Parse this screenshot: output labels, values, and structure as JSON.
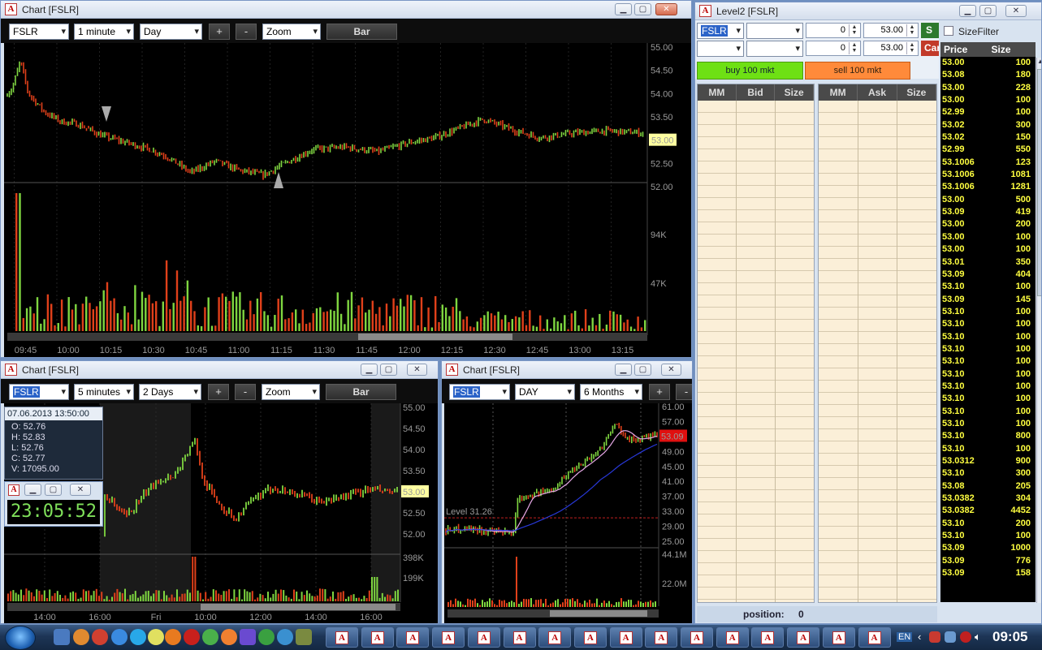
{
  "chart_main": {
    "title": "Chart [FSLR]",
    "symbol": "FSLR",
    "interval": "1 minute",
    "range": "Day",
    "zoom_plus": "+",
    "zoom_minus": "-",
    "zoom": "Zoom",
    "style": "Bar",
    "price_ticks": [
      "55.00",
      "54.50",
      "54.00",
      "53.50",
      "53.00",
      "52.50",
      "52.00"
    ],
    "last_price": "53.00",
    "vol_ticks": [
      "94K",
      "47K"
    ],
    "time_ticks": [
      "09:45",
      "10:00",
      "10:15",
      "10:30",
      "10:45",
      "11:00",
      "11:15",
      "11:30",
      "11:45",
      "12:00",
      "12:15",
      "12:30",
      "12:45",
      "13:00",
      "13:15"
    ]
  },
  "chart_5m": {
    "title": "Chart [FSLR]",
    "symbol": "FSLR",
    "interval": "5 minutes",
    "range": "2 Days",
    "zoom_plus": "+",
    "zoom_minus": "-",
    "zoom": "Zoom",
    "style": "Bar",
    "price_ticks": [
      "55.00",
      "54.50",
      "54.00",
      "53.50",
      "53.00",
      "52.50",
      "52.00"
    ],
    "last_price": "53.00",
    "vol_ticks": [
      "398K",
      "199K"
    ],
    "time_ticks": [
      "14:00",
      "16:00",
      "Fri",
      "10:00",
      "12:00",
      "14:00",
      "16:00"
    ],
    "info": {
      "date": "07.06.2013 13:50:00",
      "o": "O: 52.76",
      "h": "H: 52.83",
      "l": "L: 52.76",
      "c": "C: 52.77",
      "v": "V: 17095.00"
    },
    "clock": "23:05:52"
  },
  "chart_day": {
    "title": "Chart [FSLR]",
    "symbol": "FSLR",
    "interval": "DAY",
    "range": "6 Months",
    "zoom_plus": "+",
    "zoom_minus": "-",
    "price_ticks": [
      "61.00",
      "57.00",
      "53.00",
      "49.00",
      "45.00",
      "41.00",
      "37.00",
      "33.00",
      "29.00",
      "25.00"
    ],
    "last_price": "53.09",
    "level_label": "Level 31.26",
    "vol_ticks": [
      "44.1M",
      "22.0M"
    ]
  },
  "level2": {
    "title": "Level2 [FSLR]",
    "symbol": "FSLR",
    "qty1": "0",
    "price1": "53.00",
    "qty2": "0",
    "price2": "53.00",
    "send_label": "S",
    "cancel_label": "Car",
    "buy_label": "buy 100 mkt",
    "sell_label": "sell 100 mkt",
    "bid_headers": [
      "MM",
      "Bid",
      "Size"
    ],
    "ask_headers": [
      "MM",
      "Ask",
      "Size"
    ],
    "position_label": "position:",
    "position_value": "0"
  },
  "tape": {
    "size_filter": "SizeFilter",
    "headers": [
      "Price",
      "Size"
    ],
    "rows": [
      [
        "53.00",
        "100"
      ],
      [
        "53.08",
        "180"
      ],
      [
        "53.00",
        "228"
      ],
      [
        "53.00",
        "100"
      ],
      [
        "52.99",
        "100"
      ],
      [
        "53.02",
        "300"
      ],
      [
        "53.02",
        "150"
      ],
      [
        "52.99",
        "550"
      ],
      [
        "53.1006",
        "123"
      ],
      [
        "53.1006",
        "1081"
      ],
      [
        "53.1006",
        "1281"
      ],
      [
        "53.00",
        "500"
      ],
      [
        "53.09",
        "419"
      ],
      [
        "53.00",
        "200"
      ],
      [
        "53.00",
        "100"
      ],
      [
        "53.00",
        "100"
      ],
      [
        "53.01",
        "350"
      ],
      [
        "53.09",
        "404"
      ],
      [
        "53.10",
        "100"
      ],
      [
        "53.09",
        "145"
      ],
      [
        "53.10",
        "100"
      ],
      [
        "53.10",
        "100"
      ],
      [
        "53.10",
        "100"
      ],
      [
        "53.10",
        "100"
      ],
      [
        "53.10",
        "100"
      ],
      [
        "53.10",
        "100"
      ],
      [
        "53.10",
        "100"
      ],
      [
        "53.10",
        "100"
      ],
      [
        "53.10",
        "100"
      ],
      [
        "53.10",
        "100"
      ],
      [
        "53.10",
        "800"
      ],
      [
        "53.10",
        "100"
      ],
      [
        "53.0312",
        "900"
      ],
      [
        "53.10",
        "300"
      ],
      [
        "53.08",
        "205"
      ],
      [
        "53.0382",
        "304"
      ],
      [
        "53.0382",
        "4452"
      ],
      [
        "53.10",
        "200"
      ],
      [
        "53.10",
        "100"
      ],
      [
        "53.09",
        "1000"
      ],
      [
        "53.09",
        "776"
      ],
      [
        "53.09",
        "158"
      ]
    ]
  },
  "taskbar": {
    "lang": "EN",
    "clock": "09:05"
  },
  "colors": {
    "up": "#7fd640",
    "down": "#e0401a",
    "last": "#ffffa0",
    "last_day": "#e01010",
    "tape_text": "#ffff40"
  }
}
